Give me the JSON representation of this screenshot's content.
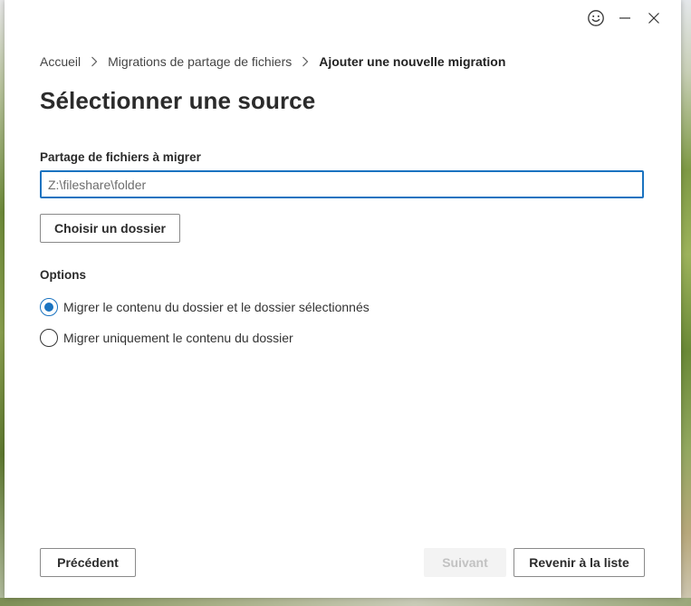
{
  "breadcrumb": {
    "items": [
      "Accueil",
      "Migrations de partage de fichiers"
    ],
    "current": "Ajouter une nouvelle migration"
  },
  "page": {
    "title": "Sélectionner une source"
  },
  "source": {
    "label": "Partage de fichiers à migrer",
    "placeholder": "Z:\\fileshare\\folder",
    "value": "",
    "choose_button": "Choisir un dossier"
  },
  "options": {
    "label": "Options",
    "items": [
      {
        "label": "Migrer le contenu du dossier et le dossier sélectionnés",
        "selected": true
      },
      {
        "label": "Migrer uniquement le contenu du dossier",
        "selected": false
      }
    ]
  },
  "footer": {
    "previous": "Précédent",
    "next": "Suivant",
    "next_disabled": true,
    "back_to_list": "Revenir à la liste"
  },
  "icons": {
    "feedback": "smiley-icon",
    "minimize": "minimize-icon",
    "close": "close-icon",
    "separator": "chevron-right-icon"
  },
  "colors": {
    "accent": "#1a73c0",
    "text": "#2b2b2b",
    "disabled_bg": "#f3f3f3",
    "disabled_text": "#c2c2c2"
  }
}
